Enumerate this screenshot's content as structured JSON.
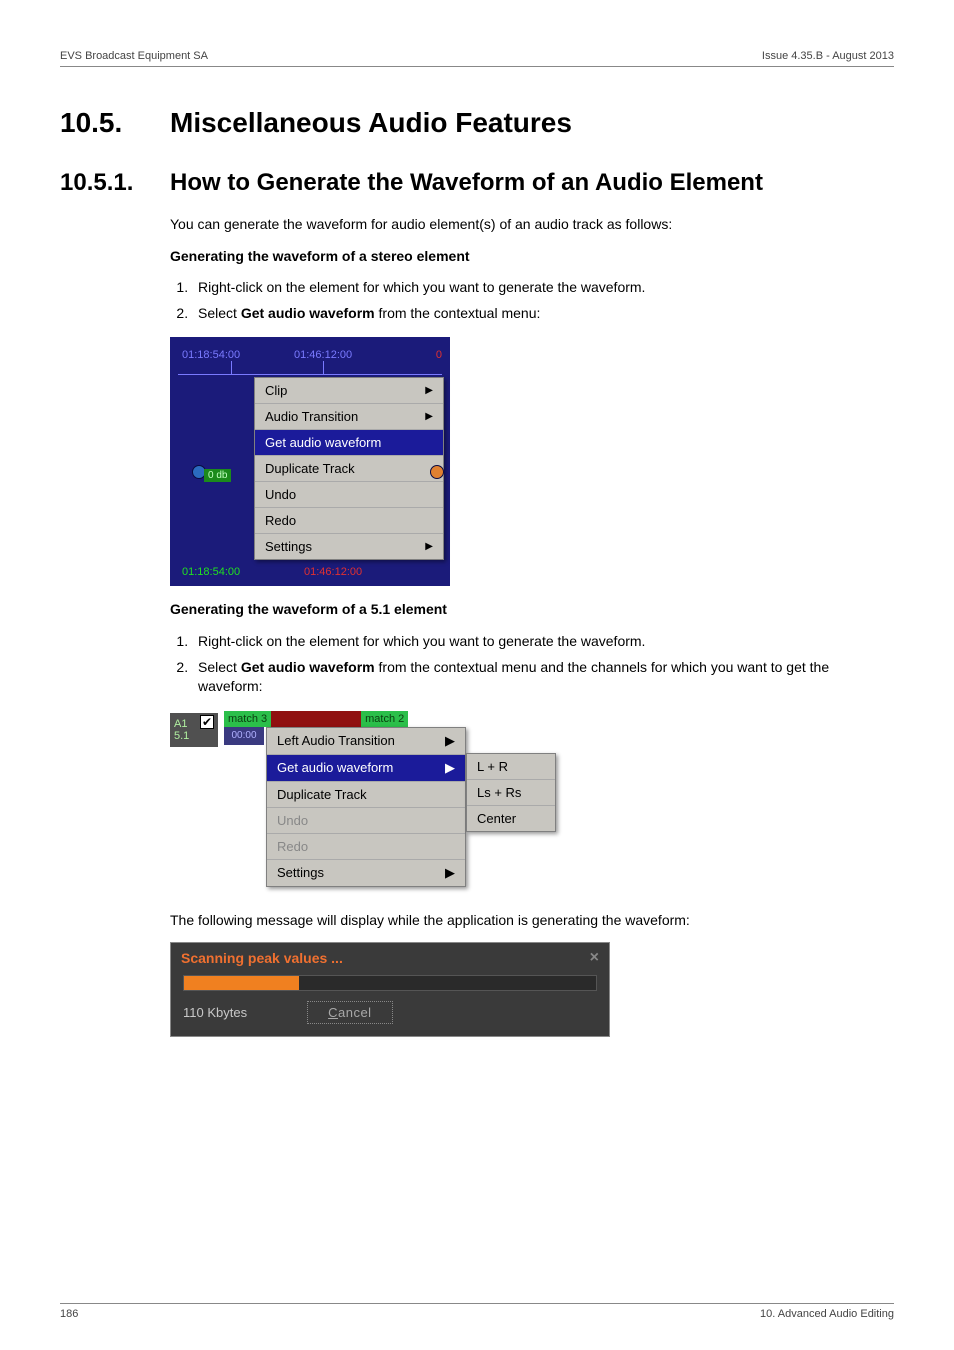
{
  "header": {
    "left": "EVS Broadcast Equipment SA",
    "right": "Issue 4.35.B - August 2013"
  },
  "section1": {
    "num": "10.5.",
    "title": "Miscellaneous Audio Features"
  },
  "section2": {
    "num": "10.5.1.",
    "title": "How to Generate the Waveform of an Audio Element"
  },
  "intro": "You can generate the waveform for audio element(s) of an audio track as follows:",
  "stereo": {
    "heading": "Generating the waveform of a stereo element",
    "step1": "Right-click on the element for which you want to generate the waveform.",
    "step2_pre": "Select ",
    "step2_bold": "Get audio waveform",
    "step2_post": " from the contextual menu:"
  },
  "menu1": {
    "tc1": "01:18:54:00",
    "tc2": "01:46:12:00",
    "tc3": "0",
    "db": "0 db",
    "items": {
      "clip": "Clip",
      "audio_transition": "Audio Transition",
      "get_wave": "Get audio waveform",
      "dup": "Duplicate Track",
      "undo": "Undo",
      "redo": "Redo",
      "settings": "Settings"
    },
    "tc1b": "01:18:54:00",
    "tc2b": "01:46:12:00"
  },
  "fiveone": {
    "heading": "Generating the waveform of a 5.1 element",
    "step1": "Right-click on the element for which you want to generate the waveform.",
    "step2_pre": "Select ",
    "step2_bold": "Get audio waveform",
    "step2_post": " from the contextual menu and the channels for which you want to get the waveform:"
  },
  "menu2": {
    "track_a": "A1",
    "track_b": "5.1",
    "chk": "✔",
    "match1": "match 3",
    "match2": "match 2",
    "time": "00:00",
    "items": {
      "left_trans": "Left Audio Transition",
      "get_wave": "Get audio waveform",
      "dup": "Duplicate Track",
      "undo": "Undo",
      "redo": "Redo",
      "settings": "Settings"
    },
    "sub": {
      "lr": "L + R",
      "lsrs": "Ls + Rs",
      "center": "Center"
    }
  },
  "after_menu2": "The following message will display while the application is generating the waveform:",
  "dlg": {
    "title": "Scanning peak values ...",
    "close": "×",
    "size": "110 Kbytes",
    "cancel_u": "C",
    "cancel_rest": "ancel"
  },
  "footer": {
    "left": "186",
    "right": "10. Advanced Audio Editing"
  }
}
